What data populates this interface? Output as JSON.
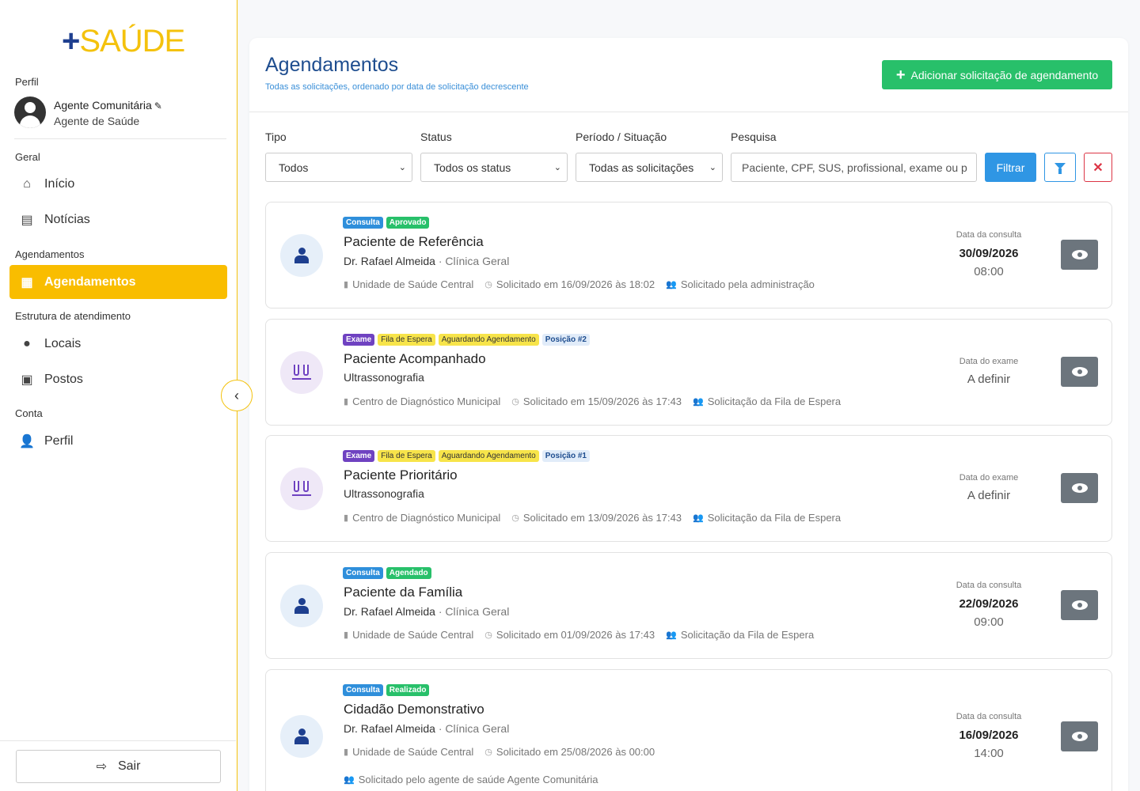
{
  "logo": {
    "plus": "+",
    "word": "SAÚDE"
  },
  "sidebar": {
    "perfil_label": "Perfil",
    "user_name": "Agente Comunitária",
    "user_role": "Agente de Saúde",
    "sections": {
      "geral": "Geral",
      "agendamentos": "Agendamentos",
      "estrutura": "Estrutura de atendimento",
      "conta": "Conta"
    },
    "items": {
      "inicio": "Início",
      "noticias": "Notícias",
      "agendamentos": "Agendamentos",
      "locais": "Locais",
      "postos": "Postos",
      "perfil": "Perfil"
    },
    "logout": "Sair"
  },
  "header": {
    "title": "Agendamentos",
    "subtitle": "Todas as solicitações, ordenado por data de solicitação decrescente",
    "add_button": "Adicionar solicitação de agendamento"
  },
  "filters": {
    "tipo_label": "Tipo",
    "tipo_value": "Todos",
    "status_label": "Status",
    "status_value": "Todos os status",
    "periodo_label": "Período / Situação",
    "periodo_value": "Todas as solicitações",
    "search_label": "Pesquisa",
    "search_placeholder": "Paciente, CPF, SUS, profissional, exame ou p",
    "filter_button": "Filtrar"
  },
  "appointments": [
    {
      "type": "Consulta",
      "status": "Aprovado",
      "patient": "Paciente de Referência",
      "professional": "Dr. Rafael Almeida",
      "specialty": "· Clínica Geral",
      "unit": "Unidade de Saúde Central",
      "requested": "Solicitado em 16/09/2026 às 18:02",
      "origin": "Solicitado pela administração",
      "date_label": "Data da consulta",
      "date": "30/09/2026",
      "time": "08:00"
    },
    {
      "type": "Exame",
      "queue": "Fila de Espera",
      "status": "Aguardando Agendamento",
      "position": "Posição #2",
      "patient": "Paciente Acompanhado",
      "exam": "Ultrassonografia",
      "unit": "Centro de Diagnóstico Municipal",
      "requested": "Solicitado em 15/09/2026 às 17:43",
      "origin": "Solicitação da Fila de Espera",
      "date_label": "Data do exame",
      "date": "A definir"
    },
    {
      "type": "Exame",
      "queue": "Fila de Espera",
      "status": "Aguardando Agendamento",
      "position": "Posição #1",
      "patient": "Paciente Prioritário",
      "exam": "Ultrassonografia",
      "unit": "Centro de Diagnóstico Municipal",
      "requested": "Solicitado em 13/09/2026 às 17:43",
      "origin": "Solicitação da Fila de Espera",
      "date_label": "Data do exame",
      "date": "A definir"
    },
    {
      "type": "Consulta",
      "status": "Agendado",
      "patient": "Paciente da Família",
      "professional": "Dr. Rafael Almeida",
      "specialty": "· Clínica Geral",
      "unit": "Unidade de Saúde Central",
      "requested": "Solicitado em 01/09/2026 às 17:43",
      "origin": "Solicitação da Fila de Espera",
      "date_label": "Data da consulta",
      "date": "22/09/2026",
      "time": "09:00"
    },
    {
      "type": "Consulta",
      "status": "Realizado",
      "patient": "Cidadão Demonstrativo",
      "professional": "Dr. Rafael Almeida",
      "specialty": "· Clínica Geral",
      "unit": "Unidade de Saúde Central",
      "requested": "Solicitado em 25/08/2026 às 00:00",
      "origin": "Solicitado pelo agente de saúde Agente Comunitária",
      "date_label": "Data da consulta",
      "date": "16/09/2026",
      "time": "14:00"
    }
  ],
  "colors": {
    "accent": "#f9bd00",
    "brand_blue": "#1e3f8f",
    "success": "#28c06a",
    "info": "#2f96e4",
    "exam": "#6f42c1"
  }
}
